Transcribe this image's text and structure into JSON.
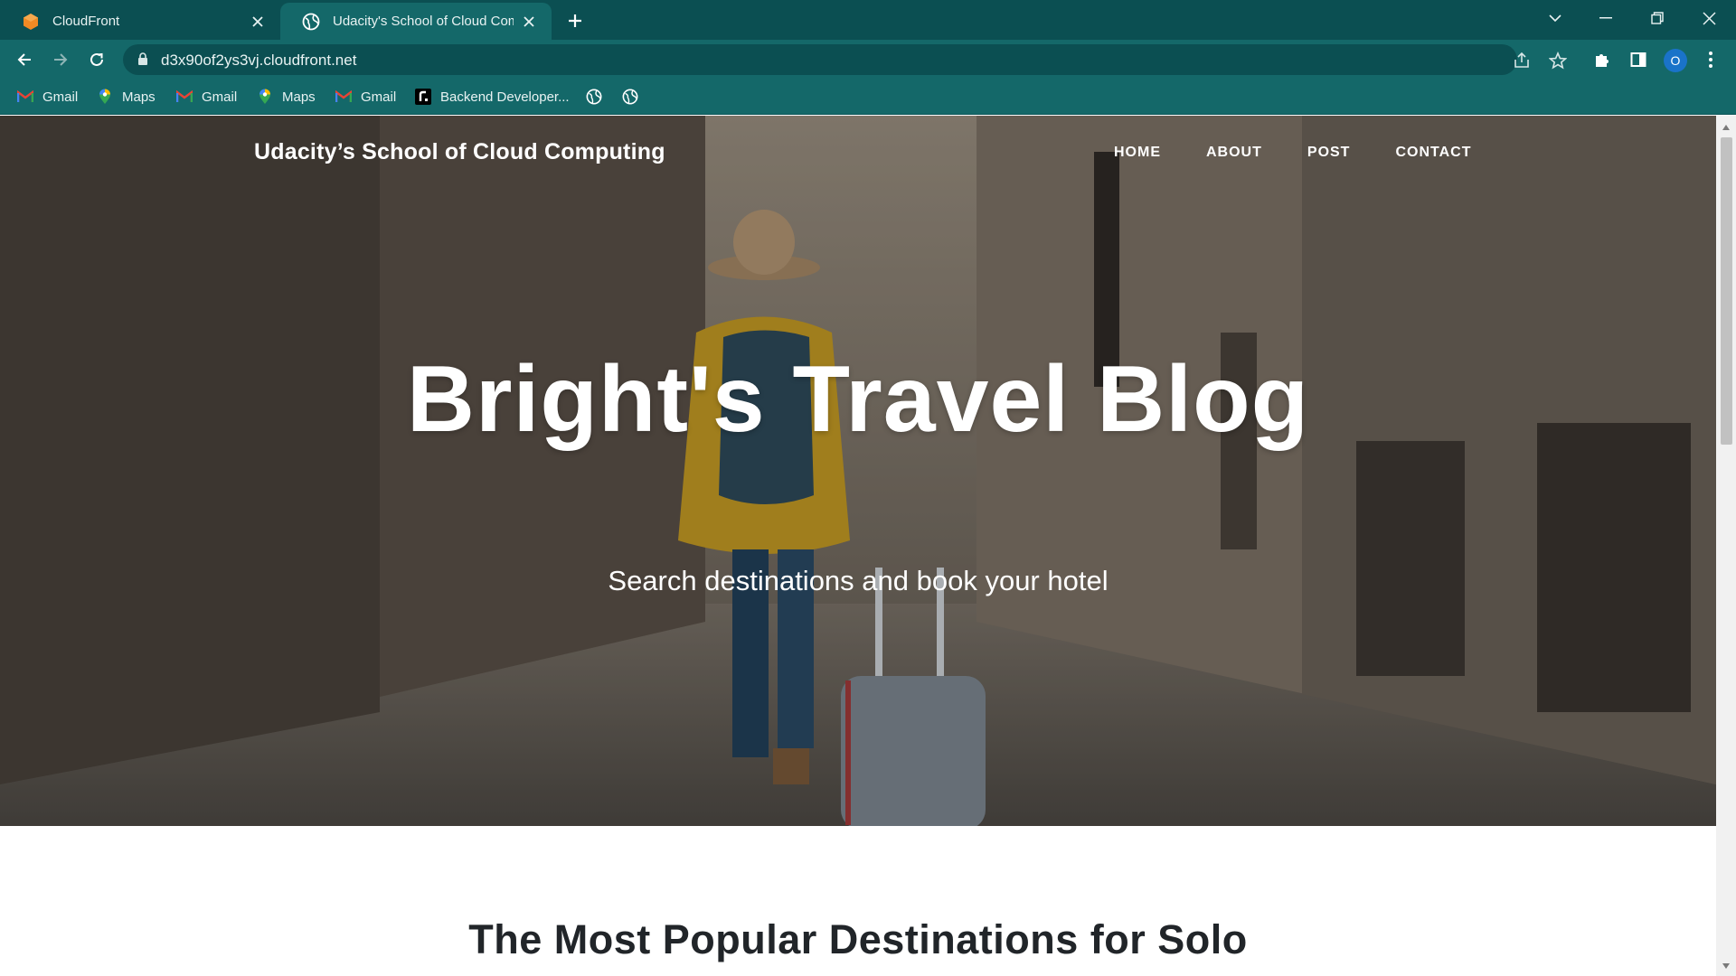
{
  "browser": {
    "tabs": [
      {
        "label": "CloudFront",
        "active": false
      },
      {
        "label": "Udacity's School of Cloud Computing",
        "active": true
      }
    ],
    "address": {
      "url": "d3x90of2ys3vj.cloudfront.net"
    },
    "bookmarks": [
      {
        "label": "Gmail",
        "icon": "gmail-icon"
      },
      {
        "label": "Maps",
        "icon": "maps-icon"
      },
      {
        "label": "Gmail",
        "icon": "gmail-icon"
      },
      {
        "label": "Maps",
        "icon": "maps-icon"
      },
      {
        "label": "Gmail",
        "icon": "gmail-icon"
      },
      {
        "label": "Backend Developer...",
        "icon": "roadmap-icon"
      }
    ],
    "profile_initial": "O",
    "colors": {
      "frame": "#0b4f52",
      "toolbar": "#146869",
      "accent": "#1a73c9"
    }
  },
  "site": {
    "brand": "Udacity’s School of Cloud Computing",
    "nav": {
      "home": "HOME",
      "about": "ABOUT",
      "post": "POST",
      "contact": "CONTACT"
    },
    "hero": {
      "title": "Bright's Travel Blog",
      "subtitle": "Search destinations and book your hotel"
    },
    "post_heading": "The Most Popular Destinations for Solo"
  }
}
